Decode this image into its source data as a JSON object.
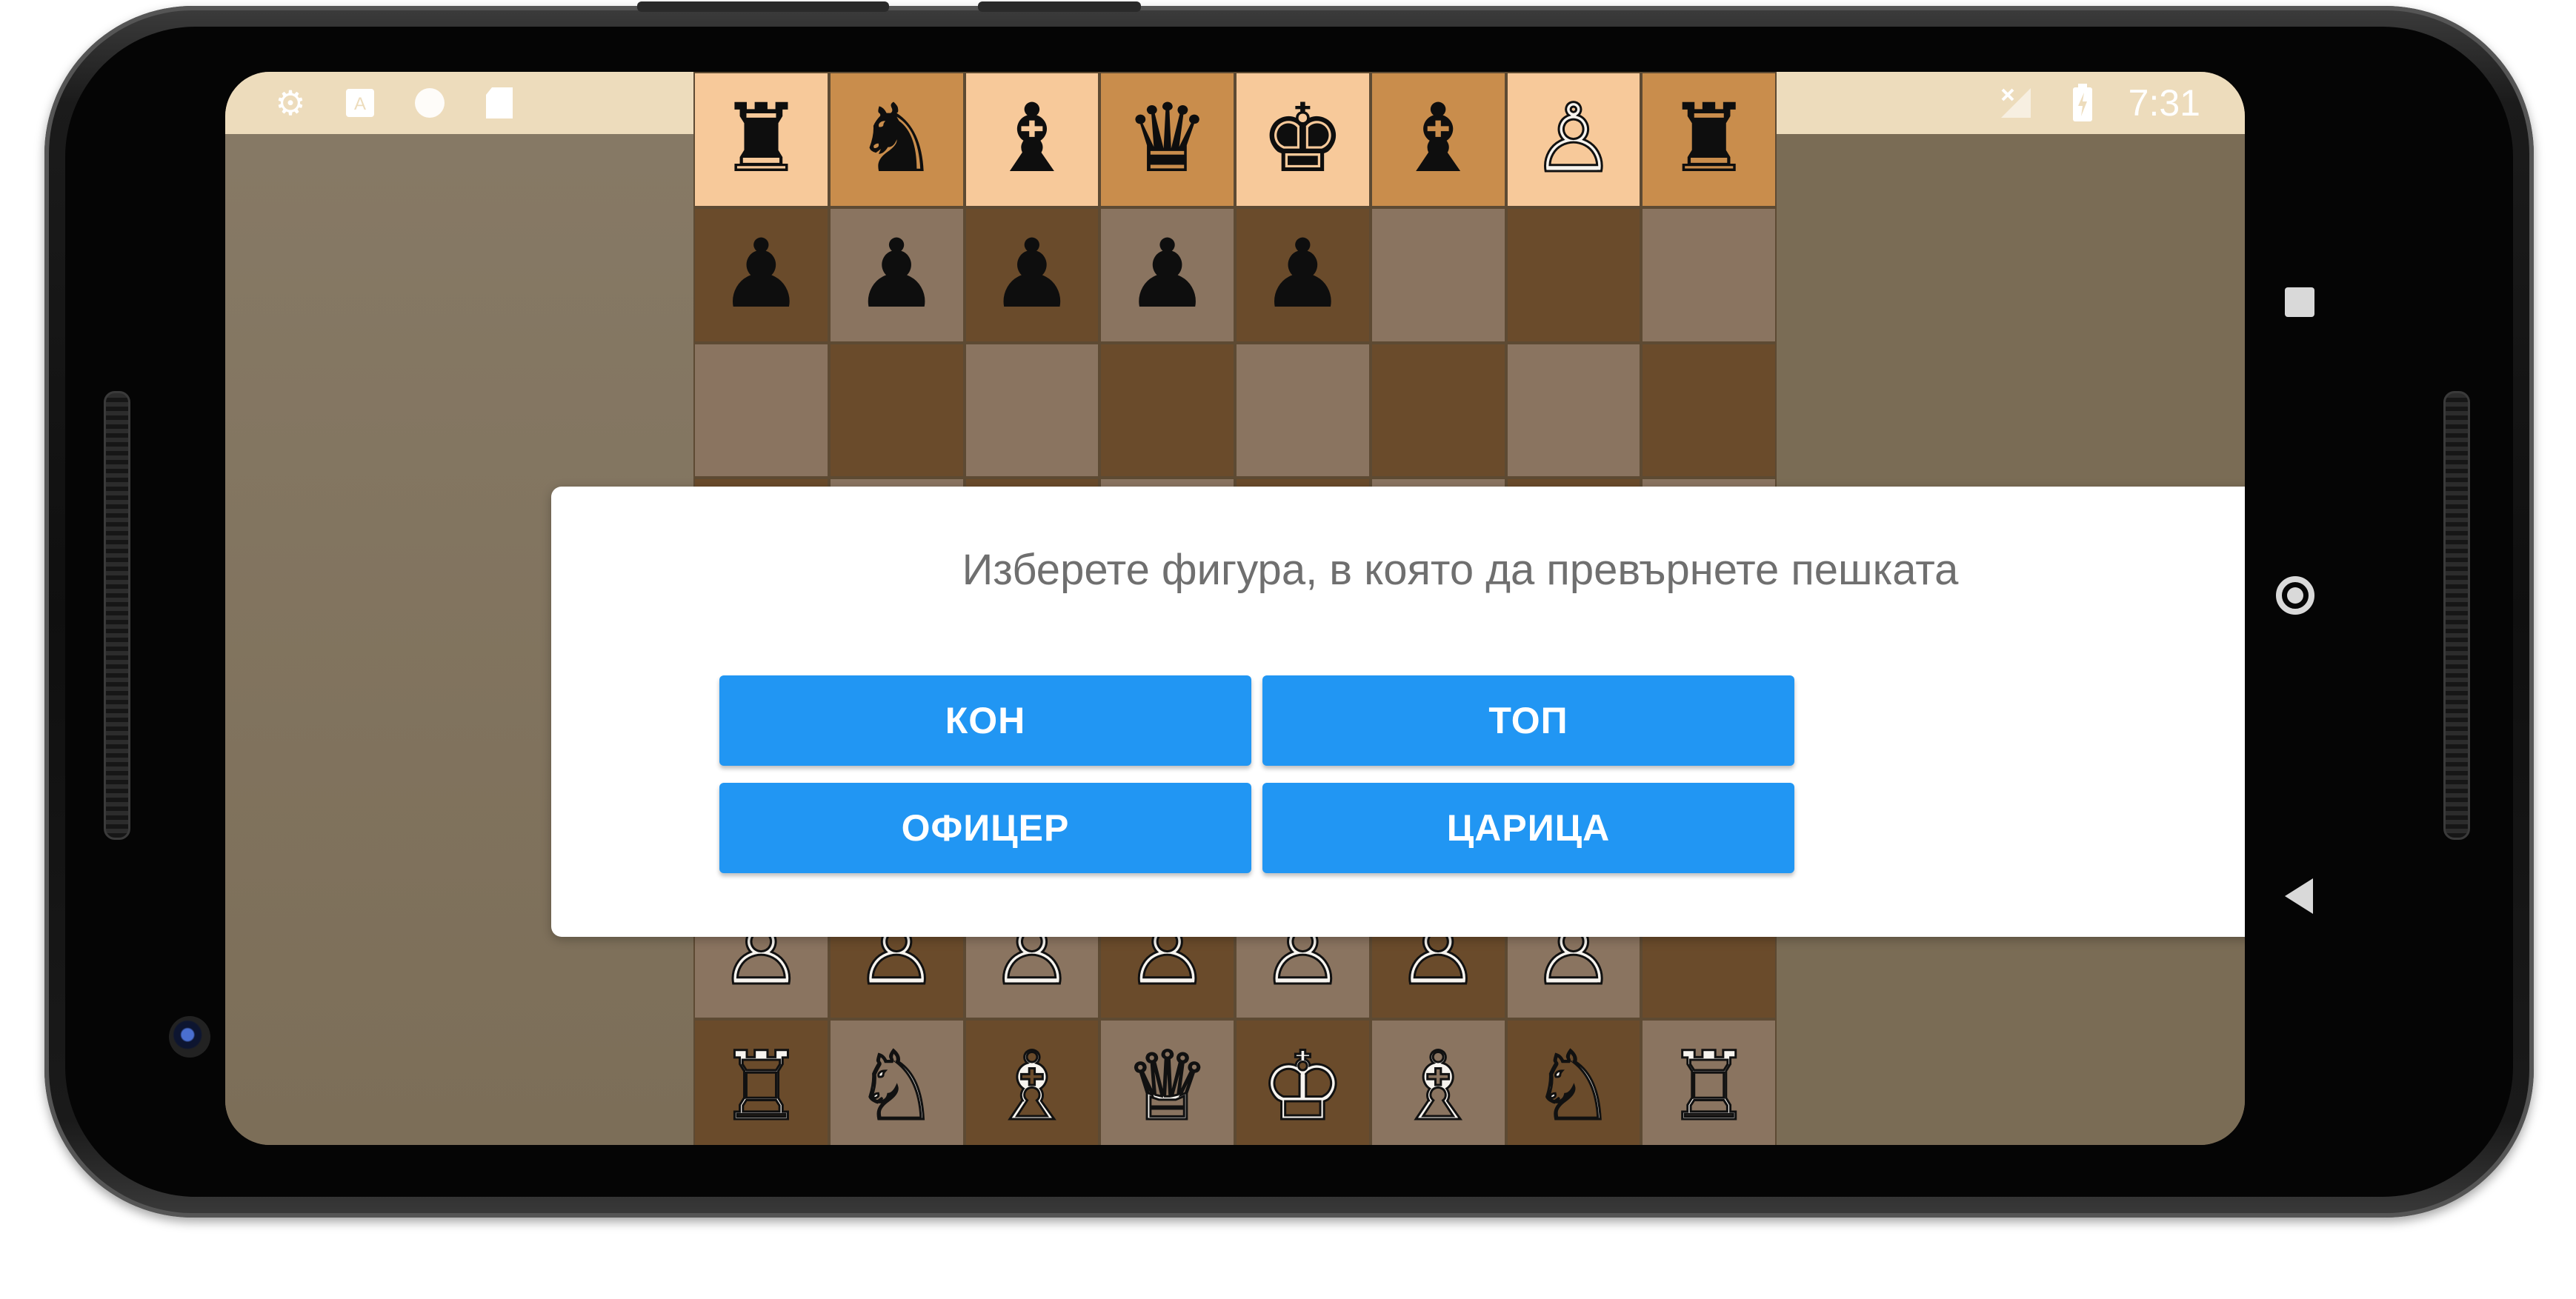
{
  "status_bar": {
    "time": "7:31",
    "left_icons": [
      "settings-icon",
      "keyboard-icon",
      "circle-icon",
      "sd-card-icon"
    ],
    "right_icons": [
      "no-signal-icon",
      "battery-charging-icon"
    ]
  },
  "board": {
    "rows": [
      [
        {
          "p": "♜",
          "c": "b"
        },
        {
          "p": "♞",
          "c": "b"
        },
        {
          "p": "♝",
          "c": "b"
        },
        {
          "p": "♛",
          "c": "b"
        },
        {
          "p": "♚",
          "c": "b"
        },
        {
          "p": "♝",
          "c": "b"
        },
        {
          "p": "♙",
          "c": "w"
        },
        {
          "p": "♜",
          "c": "b"
        }
      ],
      [
        {
          "p": "♟",
          "c": "b"
        },
        {
          "p": "♟",
          "c": "b"
        },
        {
          "p": "♟",
          "c": "b"
        },
        {
          "p": "♟",
          "c": "b"
        },
        {
          "p": "♟",
          "c": "b"
        },
        {
          "p": "",
          "c": ""
        },
        {
          "p": "",
          "c": ""
        },
        {
          "p": "",
          "c": ""
        }
      ],
      [
        {
          "p": "",
          "c": ""
        },
        {
          "p": "",
          "c": ""
        },
        {
          "p": "",
          "c": ""
        },
        {
          "p": "",
          "c": ""
        },
        {
          "p": "",
          "c": ""
        },
        {
          "p": "",
          "c": ""
        },
        {
          "p": "",
          "c": ""
        },
        {
          "p": "",
          "c": ""
        }
      ],
      [
        {
          "p": "",
          "c": ""
        },
        {
          "p": "",
          "c": ""
        },
        {
          "p": "",
          "c": ""
        },
        {
          "p": "",
          "c": ""
        },
        {
          "p": "",
          "c": ""
        },
        {
          "p": "",
          "c": ""
        },
        {
          "p": "",
          "c": ""
        },
        {
          "p": "",
          "c": ""
        }
      ],
      [
        {
          "p": "",
          "c": ""
        },
        {
          "p": "",
          "c": ""
        },
        {
          "p": "",
          "c": ""
        },
        {
          "p": "",
          "c": ""
        },
        {
          "p": "",
          "c": ""
        },
        {
          "p": "",
          "c": ""
        },
        {
          "p": "",
          "c": ""
        },
        {
          "p": "",
          "c": ""
        }
      ],
      [
        {
          "p": "",
          "c": ""
        },
        {
          "p": "",
          "c": ""
        },
        {
          "p": "",
          "c": ""
        },
        {
          "p": "",
          "c": ""
        },
        {
          "p": "",
          "c": ""
        },
        {
          "p": "",
          "c": ""
        },
        {
          "p": "",
          "c": ""
        },
        {
          "p": "",
          "c": ""
        }
      ],
      [
        {
          "p": "♙",
          "c": "w"
        },
        {
          "p": "♙",
          "c": "w"
        },
        {
          "p": "♙",
          "c": "w"
        },
        {
          "p": "♙",
          "c": "w"
        },
        {
          "p": "♙",
          "c": "w"
        },
        {
          "p": "♙",
          "c": "w"
        },
        {
          "p": "♙",
          "c": "w"
        },
        {
          "p": "",
          "c": ""
        }
      ],
      [
        {
          "p": "♖",
          "c": "w"
        },
        {
          "p": "♘",
          "c": "w"
        },
        {
          "p": "♗",
          "c": "w"
        },
        {
          "p": "♕",
          "c": "w"
        },
        {
          "p": "♔",
          "c": "w"
        },
        {
          "p": "♗",
          "c": "w"
        },
        {
          "p": "♘",
          "c": "w"
        },
        {
          "p": "♖",
          "c": "w"
        }
      ]
    ]
  },
  "dialog": {
    "title": "Изберете фигура, в която да превърнете пешката",
    "buttons": {
      "knight": "КОН",
      "rook": "ТОП",
      "bishop": "ОФИЦЕР",
      "queen": "ЦАРИЦА"
    }
  },
  "colors": {
    "accent": "#2196f3",
    "light_square": "#8a7460",
    "dark_square": "#6a4b2b",
    "highlight_light": "#f7c99a",
    "highlight_dark": "#c98d4c"
  }
}
